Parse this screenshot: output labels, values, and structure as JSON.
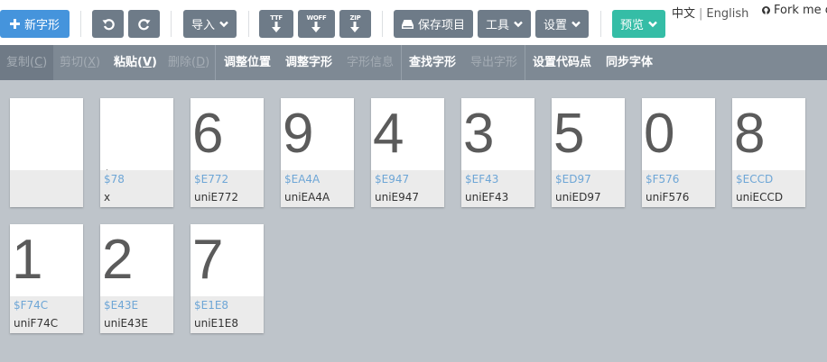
{
  "header": {
    "new_glyph_label": "新字形",
    "import_label": "导入",
    "ttf_label": "TTF",
    "woff_label": "WOFF",
    "zip_label": "ZIP",
    "save_label": "保存项目",
    "tools_label": "工具",
    "settings_label": "设置",
    "preview_label": "预览",
    "lang_current": "中文",
    "lang_separator": "|",
    "lang_other": "English",
    "fork_label": "Fork me or"
  },
  "toolbar": {
    "copy": "复制(",
    "copy_key": "C",
    "copy_end": ")",
    "cut": "剪切(",
    "cut_key": "X",
    "cut_end": ")",
    "paste": "粘贴(",
    "paste_key": "V",
    "paste_end": ")",
    "delete": "删除(",
    "delete_key": "D",
    "delete_end": ")",
    "adjust_position": "调整位置",
    "adjust_glyph": "调整字形",
    "glyph_info": "字形信息",
    "find_glyph": "查找字形",
    "export_glyph": "导出字形",
    "set_codepoint": "设置代码点",
    "sync_font": "同步字体"
  },
  "glyphs": [
    {
      "char": "",
      "code": "",
      "name": ""
    },
    {
      "char": "`",
      "code": "$78",
      "name": "x"
    },
    {
      "char": "6",
      "code": "$E772",
      "name": "uniE772"
    },
    {
      "char": "9",
      "code": "$EA4A",
      "name": "uniEA4A"
    },
    {
      "char": "4",
      "code": "$E947",
      "name": "uniE947"
    },
    {
      "char": "3",
      "code": "$EF43",
      "name": "uniEF43"
    },
    {
      "char": "5",
      "code": "$ED97",
      "name": "uniED97"
    },
    {
      "char": "0",
      "code": "$F576",
      "name": "uniF576"
    },
    {
      "char": "8",
      "code": "$ECCD",
      "name": "uniECCD"
    },
    {
      "char": "1",
      "code": "$F74C",
      "name": "uniF74C"
    },
    {
      "char": "2",
      "code": "$E43E",
      "name": "uniE43E"
    },
    {
      "char": "7",
      "code": "$E1E8",
      "name": "uniE1E8"
    }
  ],
  "colors": {
    "primary": "#4594dc",
    "toolbar": "#7e8994",
    "preview": "#35bda6",
    "code_text": "#6ea6d6"
  }
}
